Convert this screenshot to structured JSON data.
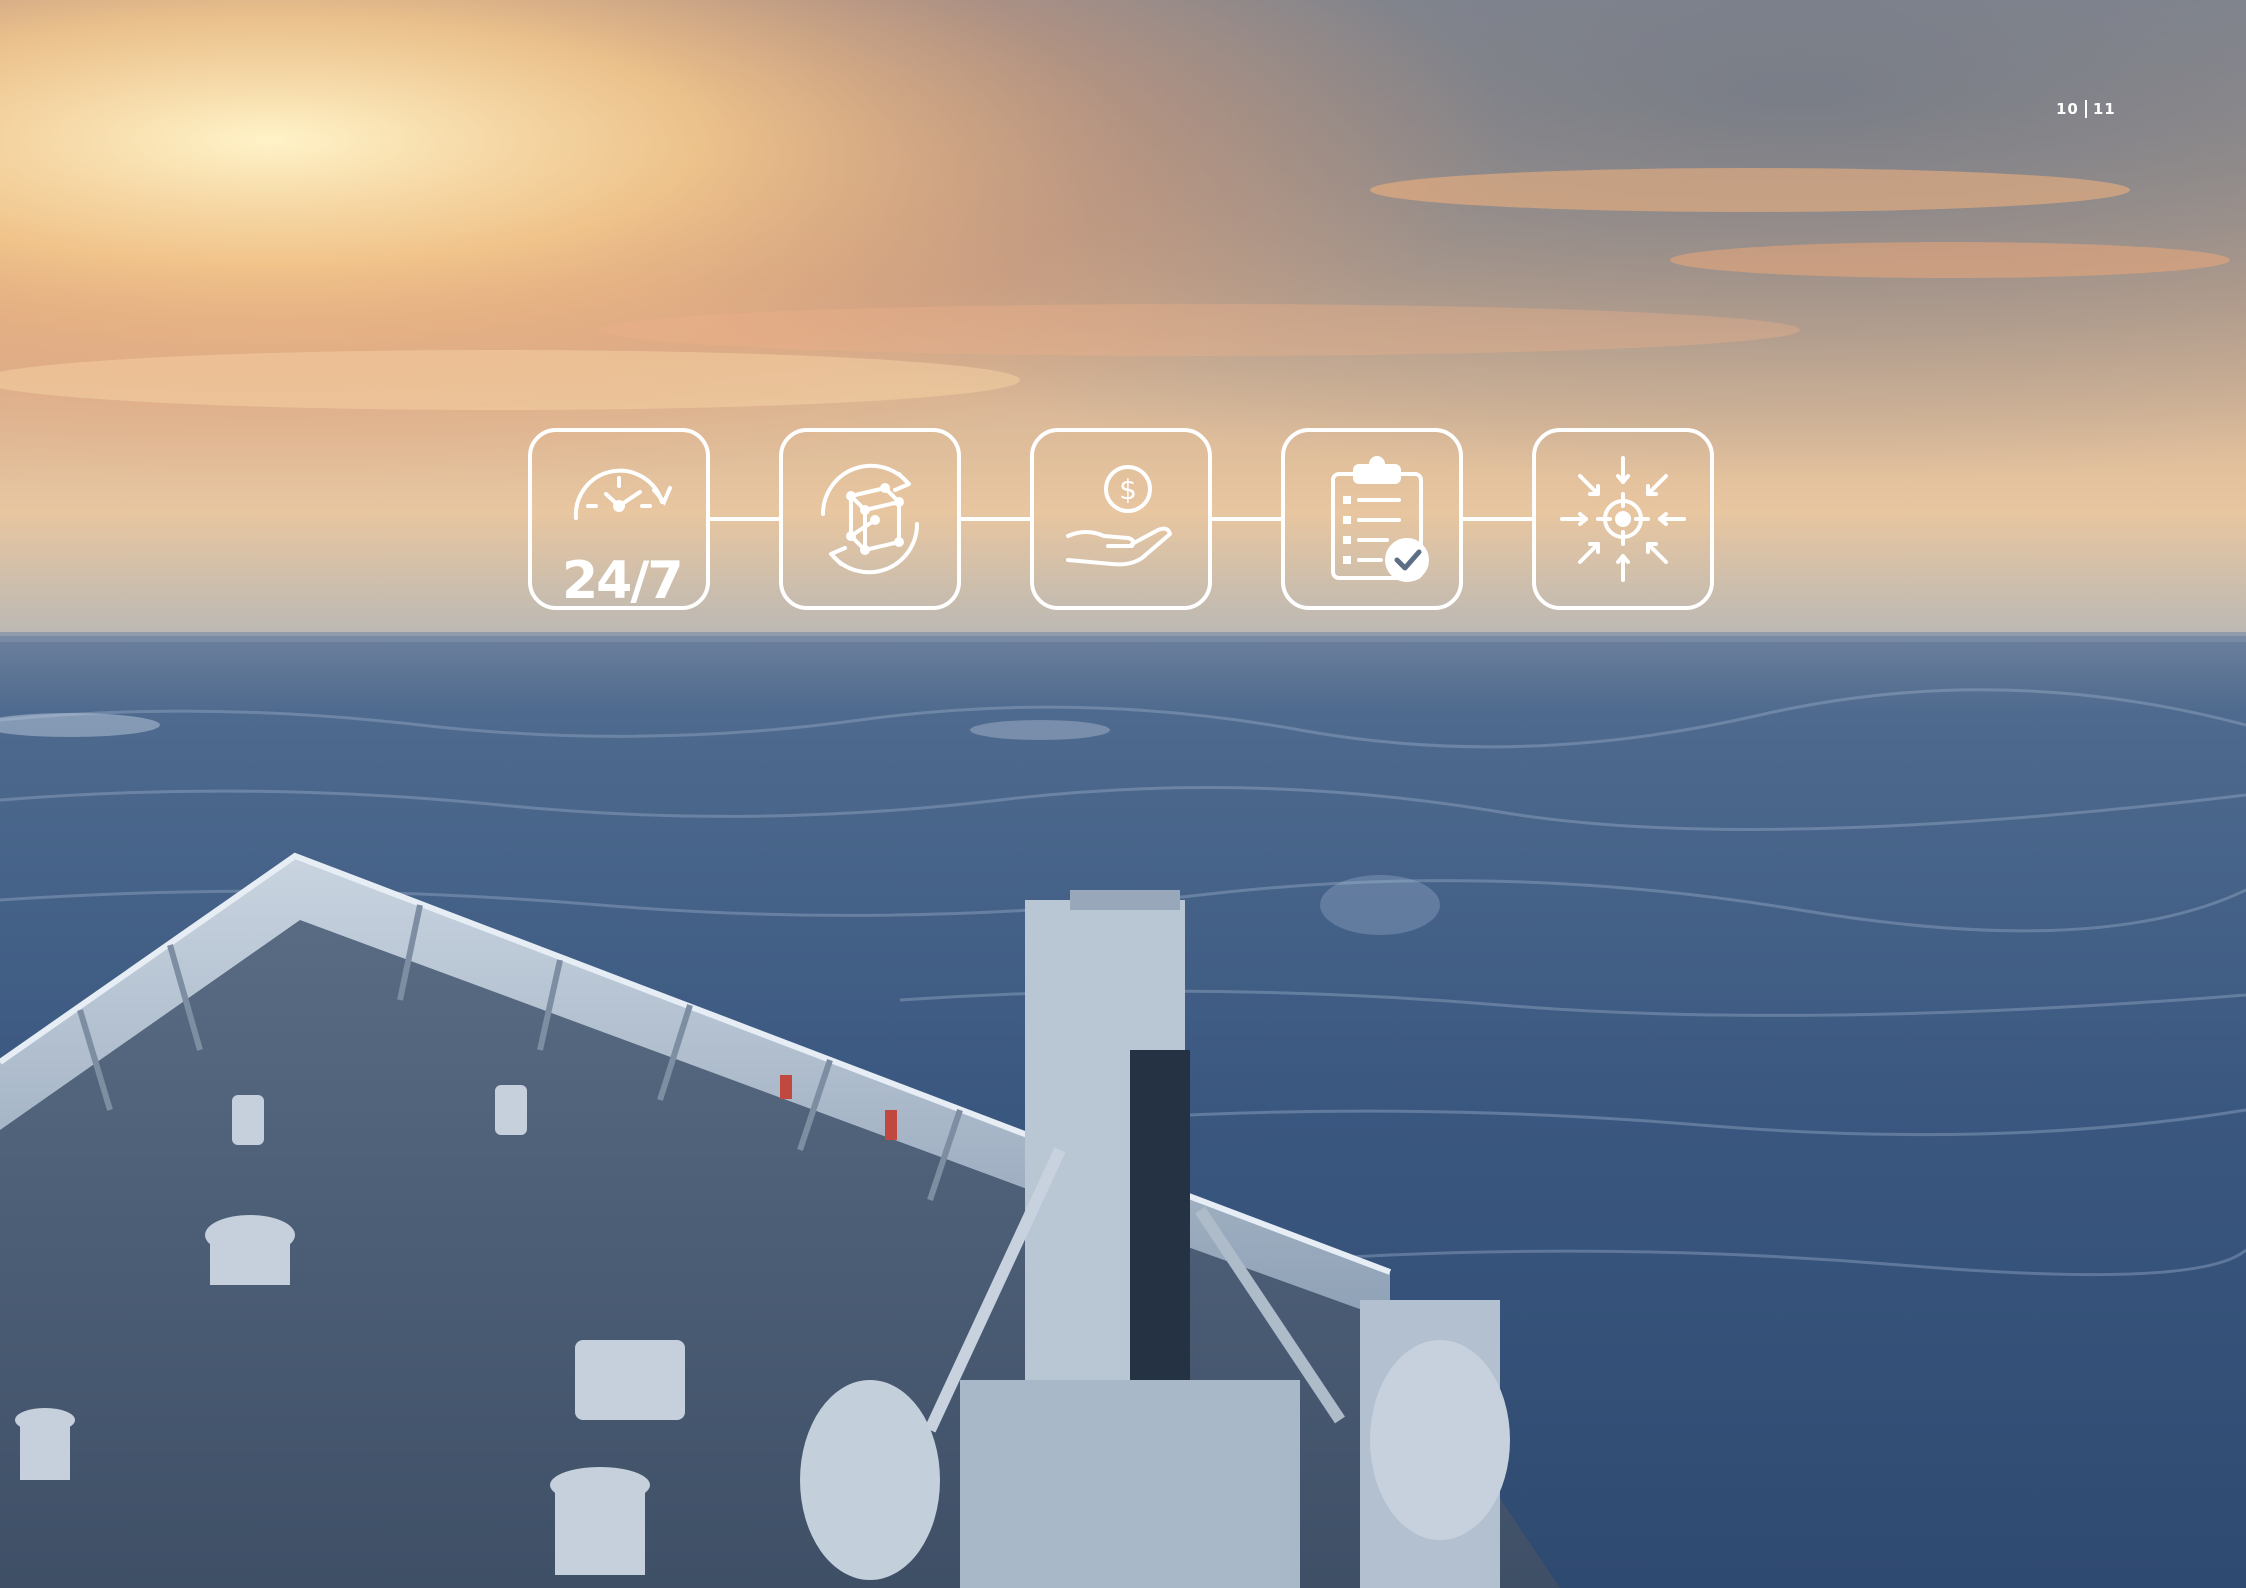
{
  "page": {
    "number_left": "10",
    "number_right": "11"
  },
  "icons": [
    {
      "name": "clock-24-7-icon",
      "label": "24/7"
    },
    {
      "name": "rotating-cube-icon"
    },
    {
      "name": "hand-holding-dollar-icon",
      "symbol": "$"
    },
    {
      "name": "clipboard-checklist-icon"
    },
    {
      "name": "target-focus-icon"
    }
  ],
  "colors": {
    "sky_glow": "#ffe6a6",
    "sky_orange": "#f3a56d",
    "sky_gray": "#8a8f99",
    "sea_blue": "#3b5b84",
    "deck_gray": "#4f6279",
    "hull_white": "#b8c6d6",
    "icon_stroke": "#ffffff"
  }
}
